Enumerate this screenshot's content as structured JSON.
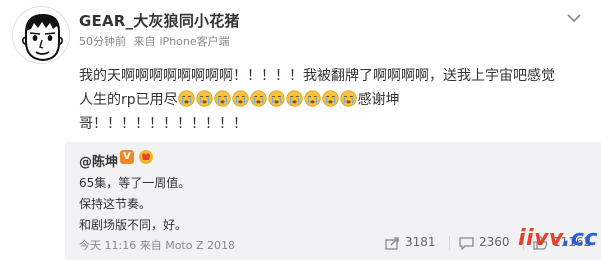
{
  "post": {
    "user_name": "GEAR_大灰狼同小花猪",
    "time": "50分钟前",
    "source_prefix": "来自",
    "source": "iPhone客户端",
    "text_line1": "我的天啊啊啊啊啊啊啊啊！！！！！我被翻牌了啊啊啊啊，送我上宇宙吧感觉",
    "text_line2_prefix": "人生的rp已用尽",
    "emoji_count": 10,
    "emoji_name": "crying-emoji",
    "text_line2_suffix": "感谢坤",
    "text_line3": "哥！！！！！！！！！！！"
  },
  "repost": {
    "author": "@陈坤",
    "verified_badge": "V",
    "line1": "65集，等了一周值。",
    "line2": "保持这节奏。",
    "line3": "和剧场版不同，好。",
    "time": "今天 11:16",
    "source_prefix": "来自",
    "source": "Moto Z 2018",
    "reposts": "3181",
    "comments": "2360",
    "likes": "11162"
  },
  "watermark": {
    "part1": "iivv",
    "part2": ".cc"
  },
  "colors": {
    "repost_bg": "#f2f2f5",
    "verified": "#f08a24",
    "watermark_red": "#e8412c",
    "watermark_blue": "#2c5fd6"
  }
}
